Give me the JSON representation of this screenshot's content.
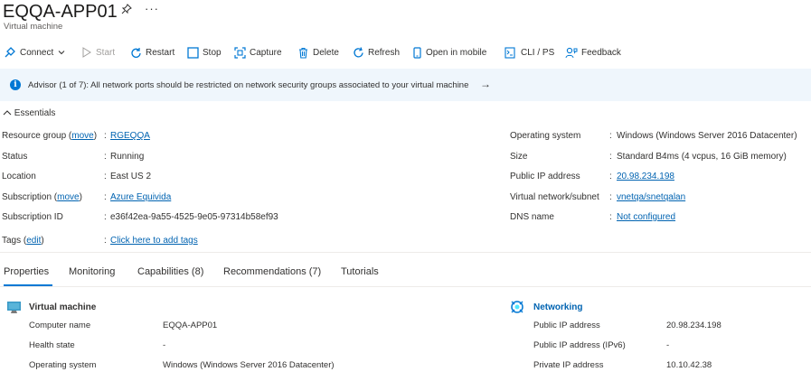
{
  "header": {
    "title": "EQQA-APP01",
    "subtitle": "Virtual machine",
    "pin_icon": "pin-icon",
    "more_icon": "more-icon"
  },
  "toolbar": {
    "connect": "Connect",
    "start": "Start",
    "restart": "Restart",
    "stop": "Stop",
    "capture": "Capture",
    "delete": "Delete",
    "refresh": "Refresh",
    "open_mobile": "Open in mobile",
    "cli": "CLI / PS",
    "feedback": "Feedback"
  },
  "advisor": {
    "text": "Advisor (1 of 7): All network ports should be restricted on network security groups associated to your virtual machine",
    "arrow": "→"
  },
  "essentials": {
    "title": "Essentials",
    "left": {
      "resource_group_label": "Resource group",
      "move": "move",
      "resource_group_value": "RGEQQA",
      "status_label": "Status",
      "status_value": "Running",
      "location_label": "Location",
      "location_value": "East US 2",
      "subscription_label": "Subscription",
      "subscription_value": "Azure Equivida",
      "subscription_id_label": "Subscription ID",
      "subscription_id_value": "e36f42ea-9a55-4525-9e05-97314b58ef93",
      "tags_label": "Tags",
      "edit": "edit",
      "tags_value": "Click here to add tags"
    },
    "right": {
      "os_label": "Operating system",
      "os_value": "Windows (Windows Server 2016 Datacenter)",
      "size_label": "Size",
      "size_value": "Standard B4ms (4 vcpus, 16 GiB memory)",
      "public_ip_label": "Public IP address",
      "public_ip_value": "20.98.234.198",
      "vnet_label": "Virtual network/subnet",
      "vnet_value": "vnetqa/snetqalan",
      "dns_label": "DNS name",
      "dns_value": "Not configured"
    }
  },
  "tabs": [
    "Properties",
    "Monitoring",
    "Capabilities (8)",
    "Recommendations (7)",
    "Tutorials"
  ],
  "properties": {
    "vm": {
      "title": "Virtual machine",
      "rows": [
        {
          "label": "Computer name",
          "value": "EQQA-APP01"
        },
        {
          "label": "Health state",
          "value": "-"
        },
        {
          "label": "Operating system",
          "value": "Windows (Windows Server 2016 Datacenter)"
        }
      ]
    },
    "networking": {
      "title": "Networking",
      "rows": [
        {
          "label": "Public IP address",
          "value": "20.98.234.198"
        },
        {
          "label": "Public IP address (IPv6)",
          "value": "-"
        },
        {
          "label": "Private IP address",
          "value": "10.10.42.38"
        }
      ]
    }
  },
  "colors": {
    "accent": "#0078d4",
    "link": "#0063b1",
    "advisor_bg": "#eff6fc"
  }
}
